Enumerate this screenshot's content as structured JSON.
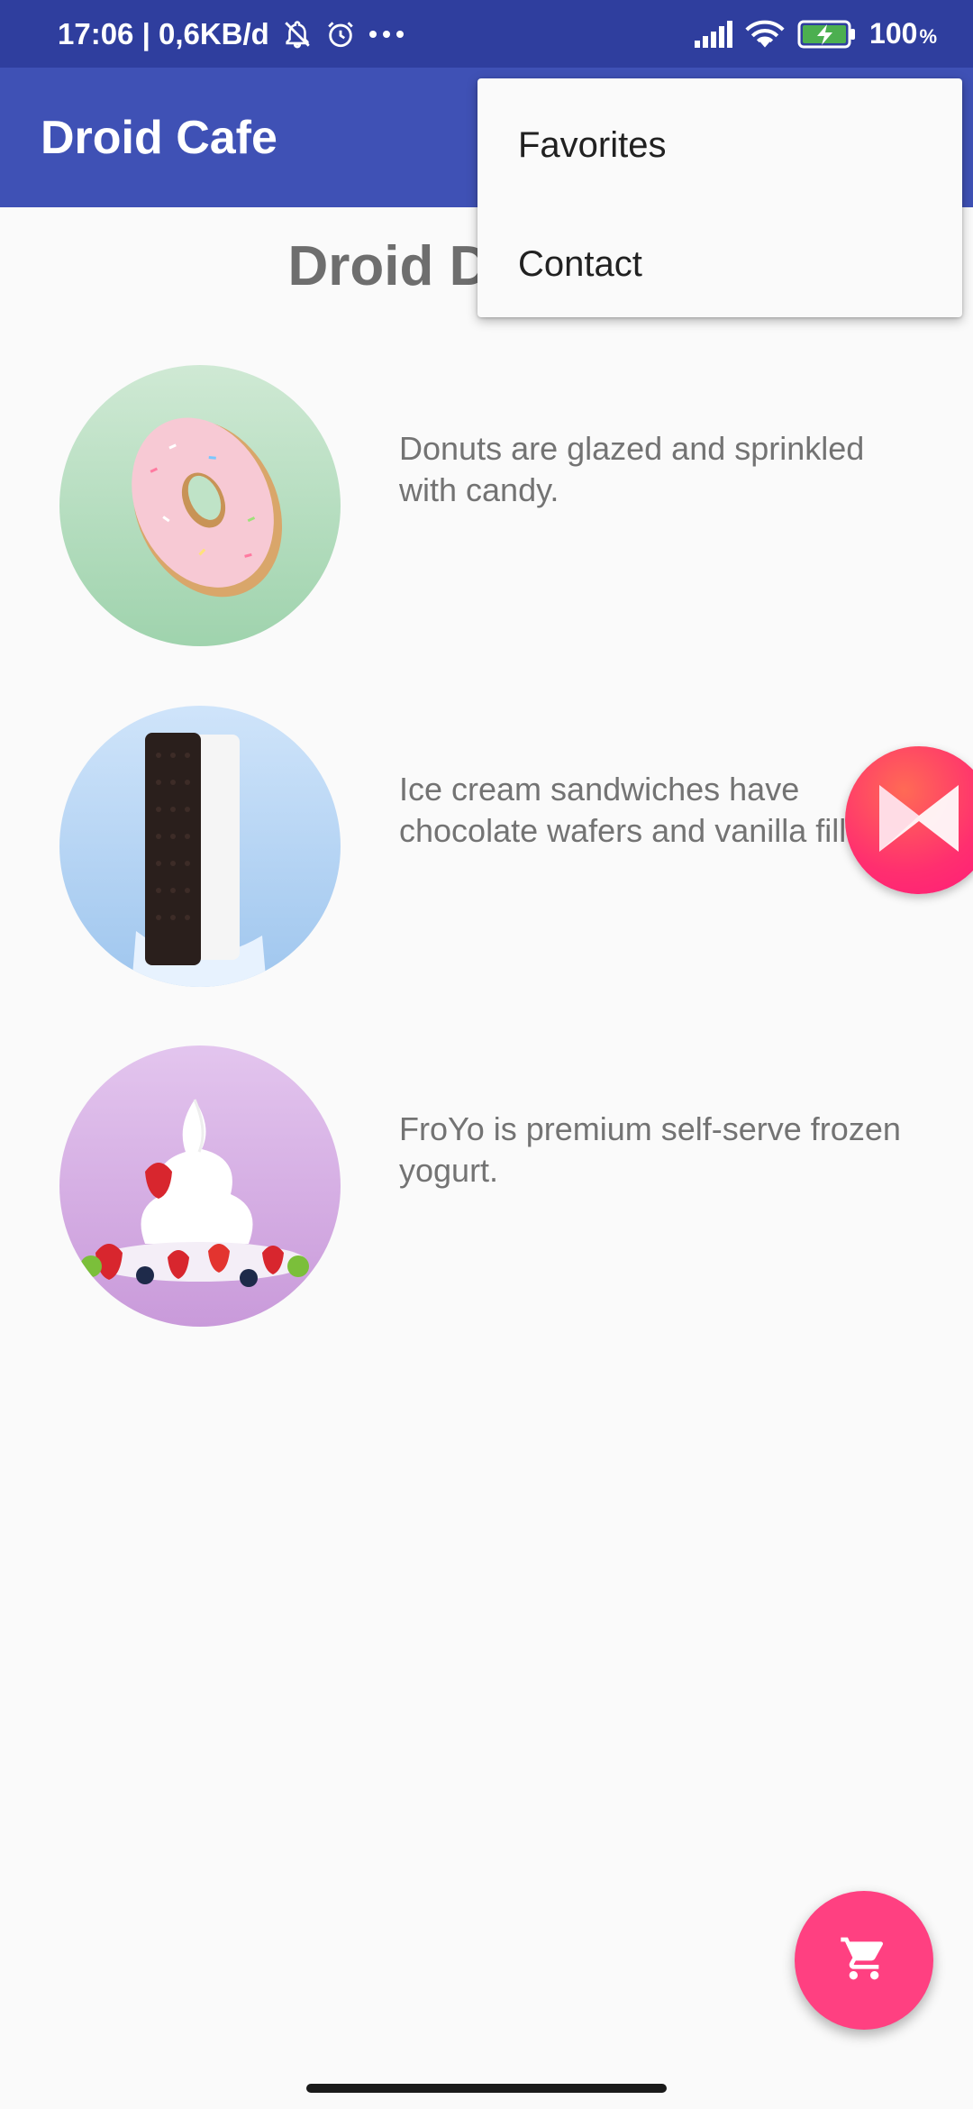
{
  "status_bar": {
    "time_and_speed": "17:06 | 0,6KB/d",
    "battery_percent": "100",
    "percent_sign": "%"
  },
  "app_bar": {
    "title": "Droid Cafe"
  },
  "page": {
    "heading": "Droid Desserts"
  },
  "items": [
    {
      "description": "Donuts are glazed and sprinkled with candy.",
      "icon": "donut-image"
    },
    {
      "description": "Ice cream sandwiches have chocolate wafers and vanilla filling.",
      "icon": "ice-cream-sandwich-image"
    },
    {
      "description": "FroYo is premium self-serve frozen yogurt.",
      "icon": "froyo-image"
    }
  ],
  "overflow_menu": {
    "items": [
      {
        "label": "Favorites"
      },
      {
        "label": "Contact"
      }
    ]
  },
  "fab": {
    "icon": "shopping-cart-icon"
  },
  "colors": {
    "primary": "#3f51b5",
    "primary_dark": "#2f3e9e",
    "accent": "#ff4081",
    "battery_fill": "#4caf50"
  }
}
